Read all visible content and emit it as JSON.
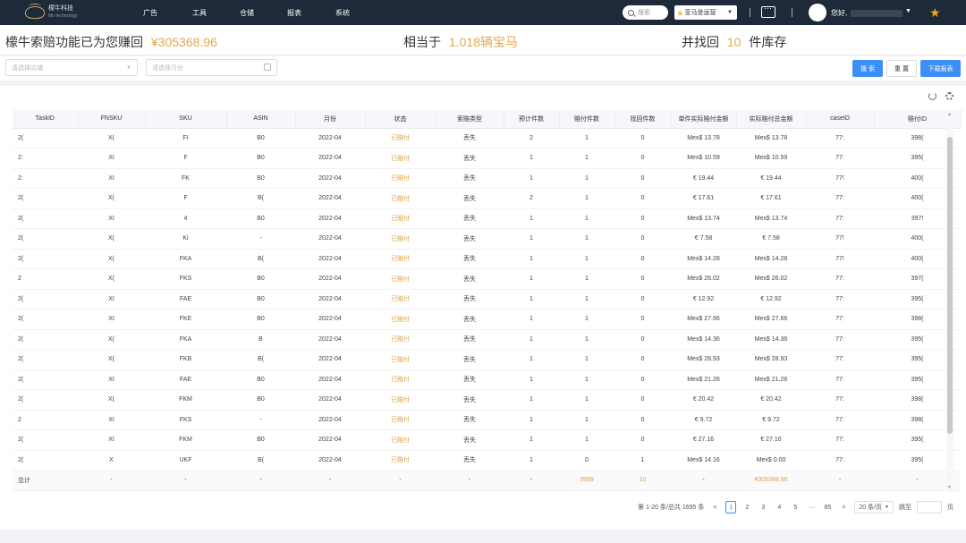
{
  "nav": {
    "logo_text": "檬牛科技",
    "logo_sub": "Mn technology",
    "menu": [
      "广告",
      "工具",
      "仓储",
      "报表",
      "系统"
    ],
    "search_placeholder": "搜索",
    "store": "亚马逊运营",
    "greeting": "您好,",
    "colors": {
      "bg": "#1e2a3a",
      "star": "#f2a31b"
    }
  },
  "banner": {
    "earned_label": "檬牛索赔功能已为您赚回",
    "earned_value": "¥305368.96",
    "equiv_label": "相当于",
    "equiv_value": "1.018辆宝马",
    "recover_label": "并找回",
    "recover_value": "10",
    "recover_unit": "件库存",
    "accent": "#e2a84b"
  },
  "filters": {
    "shop_placeholder": "请选择店铺",
    "month_placeholder": "请选择月份",
    "search_btn": "搜 索",
    "reset_btn": "重 置",
    "download_btn": "下载报表"
  },
  "table": {
    "headers": [
      "TaskID",
      "FNSKU",
      "SKU",
      "ASIN",
      "月份",
      "状态",
      "索赔类型",
      "预计件数",
      "赔付件数",
      "找回件数",
      "单件实际赔付金额",
      "实际赔付总金额",
      "caseID",
      "赔付ID"
    ],
    "rows": [
      [
        "2(",
        "X(",
        "FI",
        "B0",
        "2022-04",
        "已赔付",
        "丢失",
        "2",
        "1",
        "0",
        "Mex$ 13.78",
        "Mex$ 13.78",
        "77:",
        "398("
      ],
      [
        "2:",
        "XI",
        "F",
        "B0",
        "2022-04",
        "已赔付",
        "丢失",
        "1",
        "1",
        "0",
        "Mex$ 10.59",
        "Mex$ 10.59",
        "77:",
        "395("
      ],
      [
        "2:",
        "XI",
        "FK",
        "B0",
        "2022-04",
        "已赔付",
        "丢失",
        "1",
        "1",
        "0",
        "€ 19.44",
        "€ 19.44",
        "77!",
        "400("
      ],
      [
        "2(",
        "X(",
        "F",
        "B(",
        "2022-04",
        "已赔付",
        "丢失",
        "2",
        "1",
        "0",
        "€ 17.61",
        "€ 17.61",
        "77:",
        "400("
      ],
      [
        "2(",
        "XI",
        "4",
        "B0",
        "2022-04",
        "已赔付",
        "丢失",
        "1",
        "1",
        "0",
        "Mex$ 13.74",
        "Mex$ 13.74",
        "77:",
        "397!"
      ],
      [
        "2(",
        "X(",
        "Ki",
        "-",
        "2022-04",
        "已赔付",
        "丢失",
        "1",
        "1",
        "0",
        "€ 7.58",
        "€ 7.58",
        "77!",
        "400("
      ],
      [
        "2(",
        "X(",
        "FKA",
        "B(",
        "2022-04",
        "已赔付",
        "丢失",
        "1",
        "1",
        "0",
        "Mex$ 14.28",
        "Mex$ 14.28",
        "77!",
        "400("
      ],
      [
        "2",
        "X(",
        "FKS",
        "B0",
        "2022-04",
        "已赔付",
        "丢失",
        "1",
        "1",
        "0",
        "Mex$ 26.02",
        "Mex$ 26.02",
        "77:",
        "397("
      ],
      [
        "2(",
        "XI",
        "FAE",
        "B0",
        "2022-04",
        "已赔付",
        "丢失",
        "1",
        "1",
        "0",
        "€ 12.92",
        "€ 12.92",
        "77:",
        "395("
      ],
      [
        "2(",
        "XI",
        "FKE",
        "B0",
        "2022-04",
        "已赔付",
        "丢失",
        "1",
        "1",
        "0",
        "Mex$ 27.66",
        "Mex$ 27.66",
        "77:",
        "398("
      ],
      [
        "2(",
        "X(",
        "FKA",
        "B",
        "2022-04",
        "已赔付",
        "丢失",
        "1",
        "1",
        "0",
        "Mex$ 14.36",
        "Mex$ 14.36",
        "77:",
        "395("
      ],
      [
        "2(",
        "X(",
        "FKB",
        "B(",
        "2022-04",
        "已赔付",
        "丢失",
        "1",
        "1",
        "0",
        "Mex$ 28.93",
        "Mex$ 28.93",
        "77:",
        "395("
      ],
      [
        "2(",
        "XI",
        "FAE",
        "B0",
        "2022-04",
        "已赔付",
        "丢失",
        "1",
        "1",
        "0",
        "Mex$ 21.26",
        "Mex$ 21.26",
        "77:",
        "395("
      ],
      [
        "2(",
        "X(",
        "FKM",
        "B0",
        "2022-04",
        "已赔付",
        "丢失",
        "1",
        "1",
        "0",
        "€ 20.42",
        "€ 20.42",
        "77:",
        "398("
      ],
      [
        "2",
        "XI",
        "FKS",
        "-",
        "2022-04",
        "已赔付",
        "丢失",
        "1",
        "1",
        "0",
        "€ 9.72",
        "€ 9.72",
        "77:",
        "398("
      ],
      [
        "2(",
        "XI",
        "FKM",
        "B0",
        "2022-04",
        "已赔付",
        "丢失",
        "1",
        "1",
        "0",
        "€ 27.16",
        "€ 27.16",
        "77:",
        "395("
      ],
      [
        "2(",
        "X",
        "UKF",
        "B(",
        "2022-04",
        "已赔付",
        "丢失",
        "1",
        "0",
        "1",
        "Mex$ 14.16",
        "Mex$ 0.00",
        "77:",
        "395("
      ]
    ],
    "total_row": [
      "总计",
      "-",
      "-",
      "-",
      "-",
      "-",
      "-",
      "-",
      "3999",
      "10",
      "-",
      "¥305368.96",
      "-",
      "-"
    ]
  },
  "pagination": {
    "summary": "第 1-20 条/总共 1695 条",
    "prev": "<",
    "pages": [
      "1",
      "2",
      "3",
      "4",
      "5",
      "···",
      "85"
    ],
    "next": ">",
    "size": "20 条/页",
    "jump_label": "跳至",
    "jump_unit": "页"
  }
}
